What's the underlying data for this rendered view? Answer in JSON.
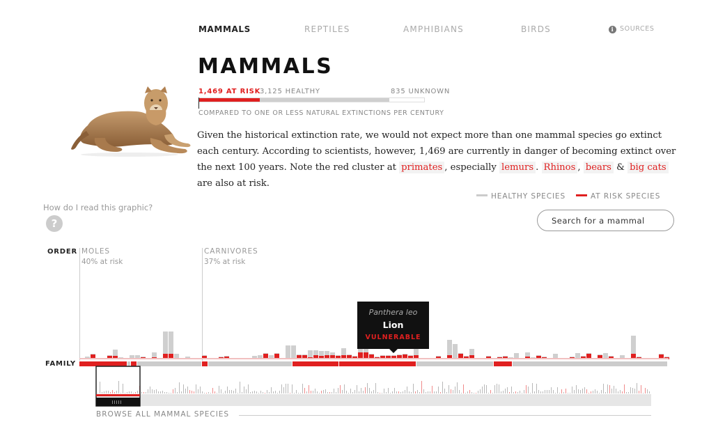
{
  "nav": {
    "tabs": [
      {
        "label": "MAMMALS",
        "active": true
      },
      {
        "label": "REPTILES",
        "active": false
      },
      {
        "label": "AMPHIBIANS",
        "active": false
      },
      {
        "label": "BIRDS",
        "active": false
      }
    ],
    "sources_label": "SOURCES",
    "sources_icon": "info-icon"
  },
  "header": {
    "title": "MAMMALS",
    "at_risk_label": "1,469 AT RISK",
    "healthy_label": "3,125 HEALTHY",
    "unknown_label": "835 UNKNOWN",
    "compared_label": "COMPARED TO ONE OR LESS NATURAL EXTINCTIONS PER CENTURY",
    "counts": {
      "at_risk": 1469,
      "healthy": 3125,
      "unknown": 835
    },
    "image": "lioness"
  },
  "description": {
    "part1": "Given the historical extinction rate, we would not expect more than one mammal species go extinct each century. According to scientists, however, 1,469 are currently in danger of becoming extinct over the next 100 years. Note the red cluster at ",
    "link_primates": "primates",
    "sep1": ", especially ",
    "link_lemurs": "lemurs",
    "sep2": ". ",
    "link_rhinos": "Rhinos",
    "sep3": ", ",
    "link_bears": "bears",
    "sep4": " & ",
    "link_bigcats": "big cats",
    "part2": " are also at risk."
  },
  "legend": {
    "healthy_label": "HEALTHY SPECIES",
    "risk_label": "AT RISK SPECIES",
    "healthy_color": "#cccccc",
    "risk_color": "#e02020"
  },
  "help": {
    "text": "How do I read this graphic?",
    "icon": "?"
  },
  "search": {
    "placeholder": "Search for a mammal"
  },
  "chart": {
    "order_label": "ORDER",
    "family_label": "FAMILY",
    "orders": [
      {
        "name": "MOLES",
        "pct": "40% at risk"
      },
      {
        "name": "CARNIVORES",
        "pct": "37% at risk"
      }
    ]
  },
  "tooltip": {
    "scientific": "Panthera leo",
    "common": "Lion",
    "status": "VULNERABLE"
  },
  "browse": {
    "label": "BROWSE ALL MAMMAL SPECIES",
    "slider_icon": "grip-icon"
  },
  "colors": {
    "risk": "#e02020",
    "healthy": "#cccccc",
    "dark": "#111111"
  }
}
